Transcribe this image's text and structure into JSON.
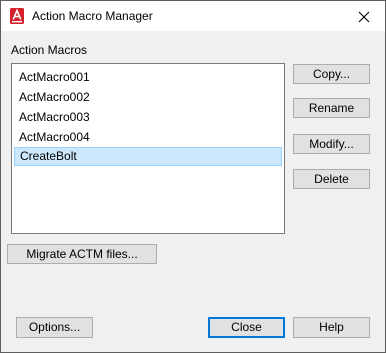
{
  "window": {
    "title": "Action Macro Manager",
    "close_glyph": "✕"
  },
  "macros": {
    "section_label": "Action Macros",
    "items": [
      {
        "label": "ActMacro001"
      },
      {
        "label": "ActMacro002"
      },
      {
        "label": "ActMacro003"
      },
      {
        "label": "ActMacro004"
      },
      {
        "label": "CreateBolt",
        "selected": true
      }
    ]
  },
  "actions": {
    "copy": "Copy...",
    "rename": "Rename",
    "modify": "Modify...",
    "delete": "Delete"
  },
  "migrate": {
    "label": "Migrate ACTM files..."
  },
  "footer": {
    "options": "Options...",
    "close": "Close",
    "help": "Help"
  },
  "colors": {
    "app_icon_red": "#d6202b",
    "selection_fill": "#cce8ff",
    "selection_border": "#99d1ff",
    "default_button_border": "#0078d7"
  },
  "icons": {
    "app": "autocad-app-icon",
    "close": "close-icon"
  }
}
